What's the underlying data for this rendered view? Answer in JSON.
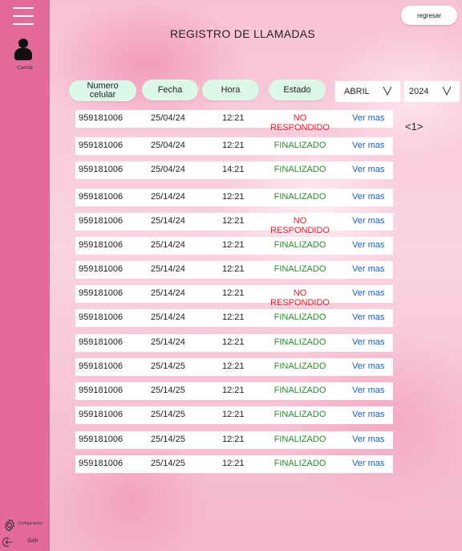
{
  "sidebar": {
    "cuenta_label": "Cuenta",
    "config_label": "Configuración",
    "salir_label": "Salir"
  },
  "header": {
    "regresar_label": "regresar",
    "title": "REGISTRO DE LLAMADAS"
  },
  "columns": {
    "numero": "Numero celular",
    "fecha": "Fecha",
    "hora": "Hora",
    "estado": "Estado"
  },
  "filters": {
    "month": "ABRIL",
    "year": "2024"
  },
  "pager": "<1>",
  "colors": {
    "sidebar": "#e46b97",
    "pill": "#dcf8e9",
    "finalizado": "#2c8a2c",
    "no_respondido": "#e0212e",
    "link": "#1d5fb0"
  },
  "rows": [
    {
      "numero": "959181006",
      "fecha": "25/04/24",
      "hora": "12:21",
      "estado": "NO RESPONDIDO",
      "ver": "Ver mas"
    },
    {
      "numero": "959181006",
      "fecha": "25/04/24",
      "hora": "12:21",
      "estado": "FINALIZADO",
      "ver": "Ver mas"
    },
    {
      "numero": "959181006",
      "fecha": "25/04/24",
      "hora": "14:21",
      "estado": "FINALIZADO",
      "ver": "Ver mas"
    },
    {
      "numero": "959181006",
      "fecha": "25/14/24",
      "hora": "12:21",
      "estado": "FINALIZADO",
      "ver": "Ver mas"
    },
    {
      "numero": "959181006",
      "fecha": "25/14/24",
      "hora": "12:21",
      "estado": "NO RESPONDIDO",
      "ver": "Ver mas"
    },
    {
      "numero": "959181006",
      "fecha": "25/14/24",
      "hora": "12:21",
      "estado": "FINALIZADO",
      "ver": "Ver mas"
    },
    {
      "numero": "959181006",
      "fecha": "25/14/24",
      "hora": "12:21",
      "estado": "FINALIZADO",
      "ver": "Ver mas"
    },
    {
      "numero": "959181006",
      "fecha": "25/14/24",
      "hora": "12:21",
      "estado": "NO RESPONDIDO",
      "ver": "Ver mas"
    },
    {
      "numero": "959181006",
      "fecha": "25/14/24",
      "hora": "12:21",
      "estado": "FINALIZADO",
      "ver": "Ver mas"
    },
    {
      "numero": "959181006",
      "fecha": "25/14/24",
      "hora": "12:21",
      "estado": "FINALIZADO",
      "ver": "Ver mas"
    },
    {
      "numero": "959181006",
      "fecha": "25/14/25",
      "hora": "12:21",
      "estado": "FINALIZADO",
      "ver": "Ver mas"
    },
    {
      "numero": "959181006",
      "fecha": "25/14/25",
      "hora": "12:21",
      "estado": "FINALIZADO",
      "ver": "Ver mas"
    },
    {
      "numero": "959181006",
      "fecha": "25/14/25",
      "hora": "12:21",
      "estado": "FINALIZADO",
      "ver": "Ver mas"
    },
    {
      "numero": "959181006",
      "fecha": "25/14/25",
      "hora": "12:21",
      "estado": "FINALIZADO",
      "ver": "Ver mas"
    },
    {
      "numero": "959181006",
      "fecha": "25/14/25",
      "hora": "12:21",
      "estado": "FINALIZADO",
      "ver": "Ver mas"
    }
  ]
}
